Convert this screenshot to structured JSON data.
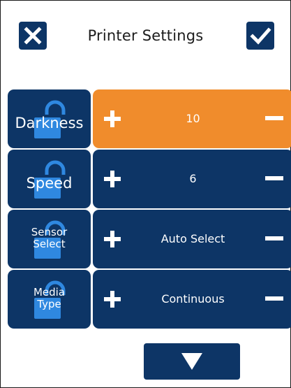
{
  "header": {
    "title": "Printer Settings",
    "close_icon": "close-icon",
    "confirm_icon": "check-icon"
  },
  "settings": [
    {
      "label": "Darkness",
      "value": "10",
      "active": true,
      "lock_icon": "unlock-icon"
    },
    {
      "label": "Speed",
      "value": "6",
      "active": false,
      "lock_icon": "unlock-icon"
    },
    {
      "label": "Sensor Select",
      "label_lines": [
        "Sensor",
        "Select"
      ],
      "value": "Auto Select",
      "active": false,
      "lock_icon": "unlock-icon"
    },
    {
      "label": "Media Type",
      "label_lines": [
        "Media",
        "Type"
      ],
      "value": "Continuous",
      "active": false,
      "lock_icon": "unlock-icon"
    }
  ],
  "controls": {
    "increment_icon": "plus-icon",
    "decrement_icon": "minus-icon"
  },
  "footer": {
    "next_icon": "chevron-down-icon"
  },
  "colors": {
    "primary": "#0d3566",
    "active": "#f08c2c",
    "lock_highlight": "#2f88e0",
    "text_light": "#ffffff",
    "background": "#ffffff"
  }
}
